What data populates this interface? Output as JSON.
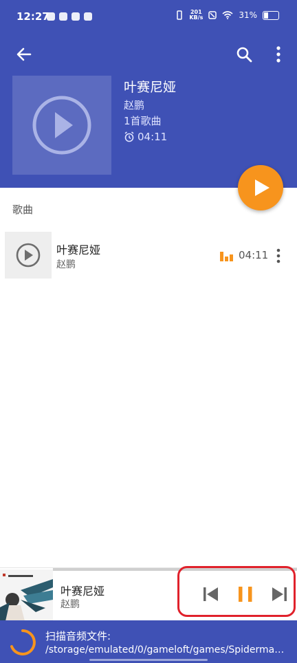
{
  "status": {
    "time": "12:27",
    "speed_value": "201",
    "speed_unit": "KB/s",
    "battery": "31%"
  },
  "header": {
    "back_icon": "arrow-left-icon",
    "search_icon": "search-icon",
    "more_icon": "more-vert-icon"
  },
  "album": {
    "title": "叶赛尼娅",
    "artist": "赵鹏",
    "count": "1首歌曲",
    "duration": "04:11"
  },
  "section": {
    "title": "歌曲"
  },
  "songs": [
    {
      "title": "叶赛尼娅",
      "artist": "赵鹏",
      "duration": "04:11"
    }
  ],
  "mini_player": {
    "title": "叶赛尼娅",
    "artist": "赵鹏",
    "progress": 0.55
  },
  "scan": {
    "label": "扫描音频文件:",
    "path": "/storage/emulated/0/gameloft/games/Spiderman…"
  },
  "colors": {
    "primary": "#3f51b5",
    "accent": "#f7941d",
    "highlight": "#e0212b"
  }
}
